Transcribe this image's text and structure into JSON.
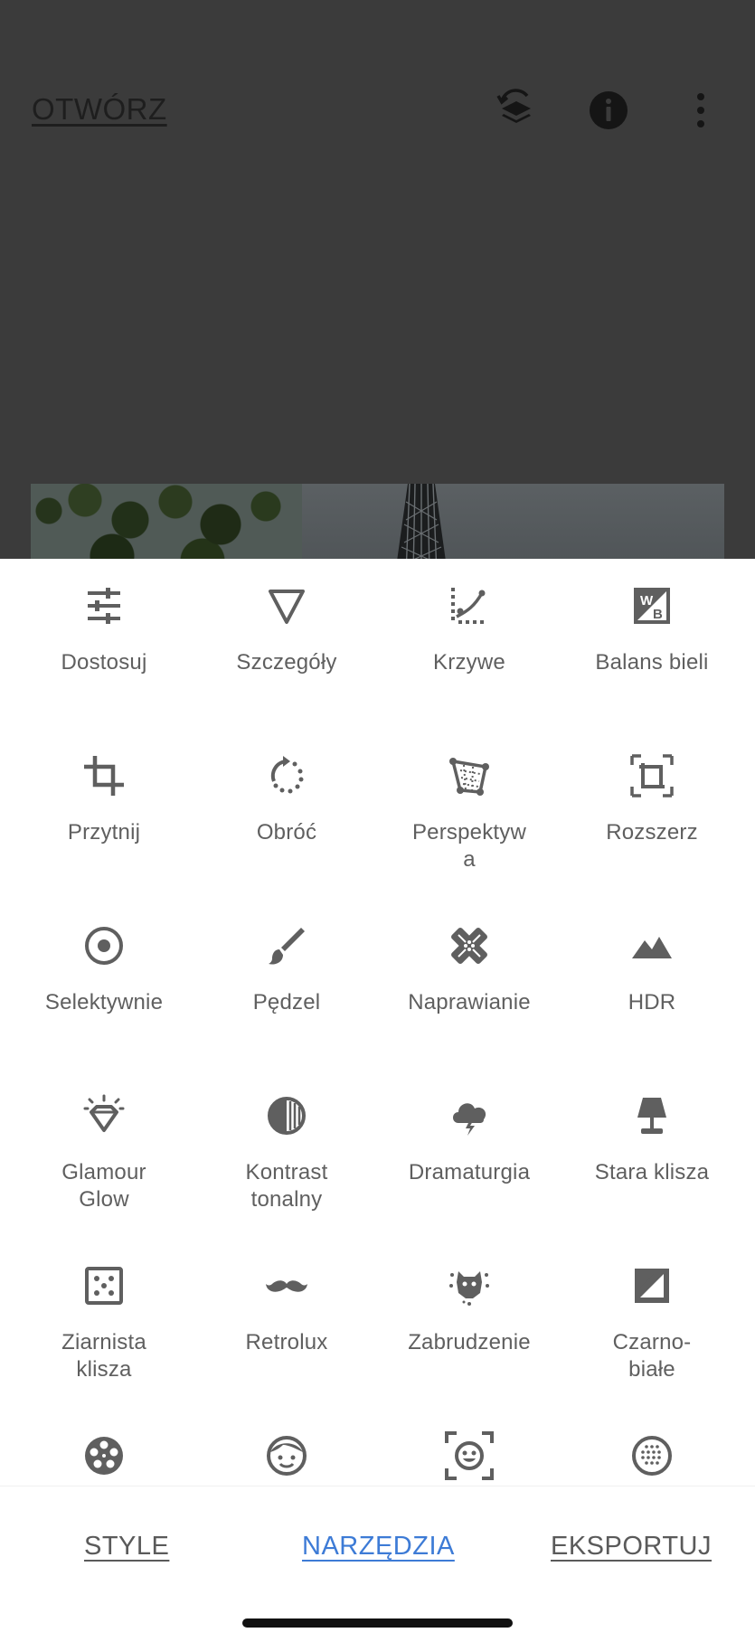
{
  "header": {
    "open_label": "OTWÓRZ",
    "icons": [
      "layers-history-icon",
      "info-icon",
      "more-vertical-icon"
    ]
  },
  "tools": [
    {
      "label": "Dostosuj",
      "icon": "tune-icon"
    },
    {
      "label": "Szczegóły",
      "icon": "details-triangle-icon"
    },
    {
      "label": "Krzywe",
      "icon": "curves-icon"
    },
    {
      "label": "Balans bieli",
      "icon": "white-balance-icon"
    },
    {
      "label": "Przytnij",
      "icon": "crop-icon"
    },
    {
      "label": "Obróć",
      "icon": "rotate-icon"
    },
    {
      "label": "Perspektyw\na",
      "icon": "perspective-icon"
    },
    {
      "label": "Rozszerz",
      "icon": "expand-icon"
    },
    {
      "label": "Selektywnie",
      "icon": "selective-icon"
    },
    {
      "label": "Pędzel",
      "icon": "brush-icon"
    },
    {
      "label": "Naprawianie",
      "icon": "healing-bandage-icon"
    },
    {
      "label": "HDR",
      "icon": "mountains-icon"
    },
    {
      "label": "Glamour\nGlow",
      "icon": "diamond-glow-icon"
    },
    {
      "label": "Kontrast\ntonalny",
      "icon": "tonal-contrast-icon"
    },
    {
      "label": "Dramaturgia",
      "icon": "storm-cloud-icon"
    },
    {
      "label": "Stara klisza",
      "icon": "lamp-icon"
    },
    {
      "label": "Ziarnista\nklisza",
      "icon": "grain-dice-icon"
    },
    {
      "label": "Retrolux",
      "icon": "mustache-icon"
    },
    {
      "label": "Zabrudzenie",
      "icon": "grunge-icon"
    },
    {
      "label": "Czarno-\nbiałe",
      "icon": "black-white-icon"
    },
    {
      "label": "",
      "icon": "film-reel-icon"
    },
    {
      "label": "",
      "icon": "face-icon"
    },
    {
      "label": "",
      "icon": "face-frame-icon"
    },
    {
      "label": "",
      "icon": "dotted-circle-icon"
    }
  ],
  "bottom_nav": {
    "style": "STYLE",
    "tools": "NARZĘDZIA",
    "export": "EKSPORTUJ",
    "active": "NARZĘDZIA",
    "active_color": "#3d7bd6"
  }
}
